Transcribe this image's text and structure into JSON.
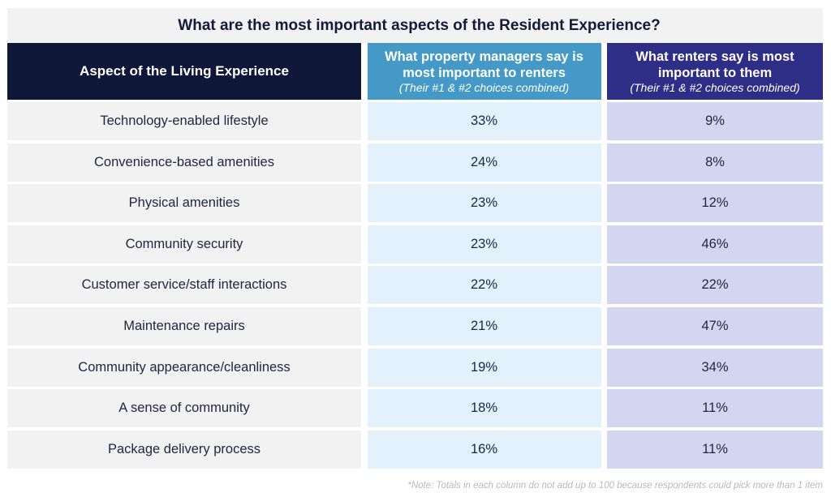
{
  "title": "What are the most important aspects of the Resident Experience?",
  "headers": {
    "aspect": "Aspect of the Living Experience",
    "managers": {
      "main": "What property managers say is most important to renters",
      "sub": "(Their #1 & #2 choices combined)"
    },
    "renters": {
      "main": "What renters say is most important to them",
      "sub": "(Their #1 & #2 choices combined)"
    }
  },
  "colors": {
    "title_band": "#f2f2f2",
    "aspect_header": "#0f1739",
    "managers_header": "#4499c6",
    "renters_header": "#2f2e86",
    "aspect_cell": "#f2f2f2",
    "managers_cell": "#e2f1fc",
    "renters_cell": "#d3d6f1"
  },
  "rows": [
    {
      "aspect": "Technology-enabled lifestyle",
      "managers": "33%",
      "renters": "9%"
    },
    {
      "aspect": "Convenience-based amenities",
      "managers": "24%",
      "renters": "8%"
    },
    {
      "aspect": "Physical amenities",
      "managers": "23%",
      "renters": "12%"
    },
    {
      "aspect": "Community security",
      "managers": "23%",
      "renters": "46%"
    },
    {
      "aspect": "Customer service/staff interactions",
      "managers": "22%",
      "renters": "22%"
    },
    {
      "aspect": "Maintenance repairs",
      "managers": "21%",
      "renters": "47%"
    },
    {
      "aspect": "Community appearance/cleanliness",
      "managers": "19%",
      "renters": "34%"
    },
    {
      "aspect": "A sense of community",
      "managers": "18%",
      "renters": "11%"
    },
    {
      "aspect": "Package delivery process",
      "managers": "16%",
      "renters": "11%"
    }
  ],
  "note": "*Note: Totals in each column do not add up to 100 because respondents could pick more than 1 item"
}
